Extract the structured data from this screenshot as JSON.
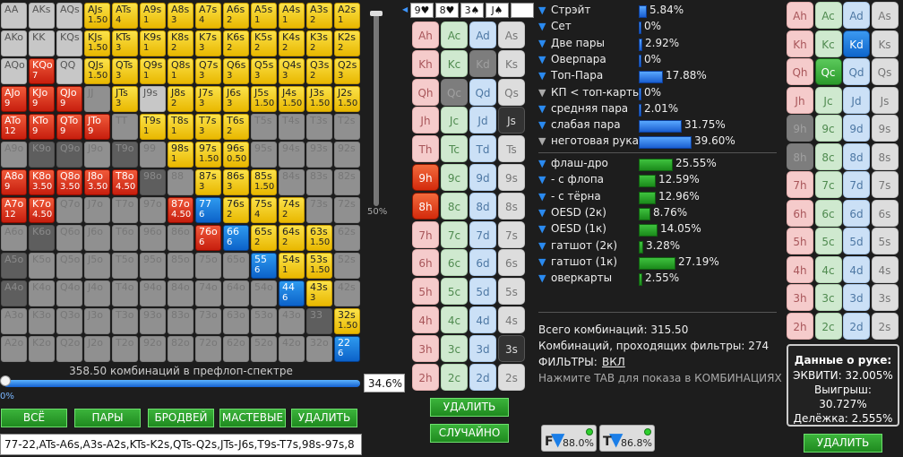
{
  "grid": [
    [
      {
        "h": "AA",
        "c": "w"
      },
      {
        "h": "AKs",
        "c": "w"
      },
      {
        "h": "AQs",
        "c": "w"
      },
      {
        "h": "AJs",
        "w": "1.50",
        "c": "y"
      },
      {
        "h": "ATs",
        "w": "4",
        "c": "y"
      },
      {
        "h": "A9s",
        "w": "1",
        "c": "y"
      },
      {
        "h": "A8s",
        "w": "3",
        "c": "y"
      },
      {
        "h": "A7s",
        "w": "4",
        "c": "y"
      },
      {
        "h": "A6s",
        "w": "2",
        "c": "y"
      },
      {
        "h": "A5s",
        "w": "1",
        "c": "y"
      },
      {
        "h": "A4s",
        "w": "1",
        "c": "y"
      },
      {
        "h": "A3s",
        "w": "2",
        "c": "y"
      },
      {
        "h": "A2s",
        "w": "1",
        "c": "y"
      }
    ],
    [
      {
        "h": "AKo",
        "c": "w"
      },
      {
        "h": "KK",
        "c": "w"
      },
      {
        "h": "KQs",
        "c": "w"
      },
      {
        "h": "KJs",
        "w": "1.50",
        "c": "y"
      },
      {
        "h": "KTs",
        "w": "3",
        "c": "y"
      },
      {
        "h": "K9s",
        "w": "1",
        "c": "y"
      },
      {
        "h": "K8s",
        "w": "2",
        "c": "y"
      },
      {
        "h": "K7s",
        "w": "3",
        "c": "y"
      },
      {
        "h": "K6s",
        "w": "2",
        "c": "y"
      },
      {
        "h": "K5s",
        "w": "2",
        "c": "y"
      },
      {
        "h": "K4s",
        "w": "2",
        "c": "y"
      },
      {
        "h": "K3s",
        "w": "2",
        "c": "y"
      },
      {
        "h": "K2s",
        "w": "2",
        "c": "y"
      }
    ],
    [
      {
        "h": "AQo",
        "c": "w"
      },
      {
        "h": "KQo",
        "w": "7",
        "c": "r"
      },
      {
        "h": "QQ",
        "c": "w"
      },
      {
        "h": "QJs",
        "w": "1.50",
        "c": "y"
      },
      {
        "h": "QTs",
        "w": "3",
        "c": "y"
      },
      {
        "h": "Q9s",
        "w": "1",
        "c": "y"
      },
      {
        "h": "Q8s",
        "w": "1",
        "c": "y"
      },
      {
        "h": "Q7s",
        "w": "3",
        "c": "y"
      },
      {
        "h": "Q6s",
        "w": "3",
        "c": "y"
      },
      {
        "h": "Q5s",
        "w": "3",
        "c": "y"
      },
      {
        "h": "Q4s",
        "w": "3",
        "c": "y"
      },
      {
        "h": "Q3s",
        "w": "2",
        "c": "y"
      },
      {
        "h": "Q2s",
        "w": "3",
        "c": "y"
      }
    ],
    [
      {
        "h": "AJo",
        "w": "9",
        "c": "r"
      },
      {
        "h": "KJo",
        "w": "9",
        "c": "r"
      },
      {
        "h": "QJo",
        "w": "9",
        "c": "r"
      },
      {
        "h": "JJ",
        "c": "g"
      },
      {
        "h": "JTs",
        "w": "3",
        "c": "y"
      },
      {
        "h": "J9s",
        "c": "w"
      },
      {
        "h": "J8s",
        "w": "2",
        "c": "y"
      },
      {
        "h": "J7s",
        "w": "3",
        "c": "y"
      },
      {
        "h": "J6s",
        "w": "3",
        "c": "y"
      },
      {
        "h": "J5s",
        "w": "1.50",
        "c": "y"
      },
      {
        "h": "J4s",
        "w": "1.50",
        "c": "y"
      },
      {
        "h": "J3s",
        "w": "1.50",
        "c": "y"
      },
      {
        "h": "J2s",
        "w": "1.50",
        "c": "y"
      }
    ],
    [
      {
        "h": "ATo",
        "w": "12",
        "c": "r"
      },
      {
        "h": "KTo",
        "w": "9",
        "c": "r"
      },
      {
        "h": "QTo",
        "w": "9",
        "c": "r"
      },
      {
        "h": "JTo",
        "w": "9",
        "c": "r"
      },
      {
        "h": "TT",
        "c": "g"
      },
      {
        "h": "T9s",
        "w": "1",
        "c": "y"
      },
      {
        "h": "T8s",
        "w": "1",
        "c": "y"
      },
      {
        "h": "T7s",
        "w": "3",
        "c": "y"
      },
      {
        "h": "T6s",
        "w": "2",
        "c": "y"
      },
      {
        "h": "T5s",
        "c": "g"
      },
      {
        "h": "T4s",
        "c": "g"
      },
      {
        "h": "T3s",
        "c": "g"
      },
      {
        "h": "T2s",
        "c": "g"
      }
    ],
    [
      {
        "h": "A9o",
        "c": "g"
      },
      {
        "h": "K9o",
        "c": "gd"
      },
      {
        "h": "Q9o",
        "c": "gd"
      },
      {
        "h": "J9o",
        "c": "g"
      },
      {
        "h": "T9o",
        "c": "gd"
      },
      {
        "h": "99",
        "c": "g"
      },
      {
        "h": "98s",
        "w": "1",
        "c": "y"
      },
      {
        "h": "97s",
        "w": "1.50",
        "c": "y"
      },
      {
        "h": "96s",
        "w": "0.50",
        "c": "y"
      },
      {
        "h": "95s",
        "c": "g"
      },
      {
        "h": "94s",
        "c": "g"
      },
      {
        "h": "93s",
        "c": "g"
      },
      {
        "h": "92s",
        "c": "g"
      }
    ],
    [
      {
        "h": "A8o",
        "w": "9",
        "c": "r"
      },
      {
        "h": "K8o",
        "w": "3.50",
        "c": "r"
      },
      {
        "h": "Q8o",
        "w": "3.50",
        "c": "r"
      },
      {
        "h": "J8o",
        "w": "3.50",
        "c": "r"
      },
      {
        "h": "T8o",
        "w": "4.50",
        "c": "r"
      },
      {
        "h": "98o",
        "c": "gd"
      },
      {
        "h": "88",
        "c": "g"
      },
      {
        "h": "87s",
        "w": "3",
        "c": "y"
      },
      {
        "h": "86s",
        "w": "3",
        "c": "y"
      },
      {
        "h": "85s",
        "w": "1.50",
        "c": "y"
      },
      {
        "h": "84s",
        "c": "g"
      },
      {
        "h": "83s",
        "c": "g"
      },
      {
        "h": "82s",
        "c": "g"
      }
    ],
    [
      {
        "h": "A7o",
        "w": "12",
        "c": "r"
      },
      {
        "h": "K7o",
        "w": "4.50",
        "c": "r"
      },
      {
        "h": "Q7o",
        "c": "g"
      },
      {
        "h": "J7o",
        "c": "g"
      },
      {
        "h": "T7o",
        "c": "g"
      },
      {
        "h": "97o",
        "c": "g"
      },
      {
        "h": "87o",
        "w": "4.50",
        "c": "r"
      },
      {
        "h": "77",
        "w": "6",
        "c": "b"
      },
      {
        "h": "76s",
        "w": "2",
        "c": "y"
      },
      {
        "h": "75s",
        "w": "4",
        "c": "y"
      },
      {
        "h": "74s",
        "w": "2",
        "c": "y"
      },
      {
        "h": "73s",
        "c": "g"
      },
      {
        "h": "72s",
        "c": "g"
      }
    ],
    [
      {
        "h": "A6o",
        "c": "g"
      },
      {
        "h": "K6o",
        "c": "gd"
      },
      {
        "h": "Q6o",
        "c": "g"
      },
      {
        "h": "J6o",
        "c": "g"
      },
      {
        "h": "T6o",
        "c": "g"
      },
      {
        "h": "96o",
        "c": "g"
      },
      {
        "h": "86o",
        "c": "g"
      },
      {
        "h": "76o",
        "w": "6",
        "c": "r"
      },
      {
        "h": "66",
        "w": "6",
        "c": "b"
      },
      {
        "h": "65s",
        "w": "2",
        "c": "y"
      },
      {
        "h": "64s",
        "w": "2",
        "c": "y"
      },
      {
        "h": "63s",
        "w": "1.50",
        "c": "y"
      },
      {
        "h": "62s",
        "c": "g"
      }
    ],
    [
      {
        "h": "A5o",
        "c": "gd"
      },
      {
        "h": "K5o",
        "c": "g"
      },
      {
        "h": "Q5o",
        "c": "g"
      },
      {
        "h": "J5o",
        "c": "g"
      },
      {
        "h": "T5o",
        "c": "g"
      },
      {
        "h": "95o",
        "c": "g"
      },
      {
        "h": "85o",
        "c": "g"
      },
      {
        "h": "75o",
        "c": "g"
      },
      {
        "h": "65o",
        "c": "g"
      },
      {
        "h": "55",
        "w": "6",
        "c": "b"
      },
      {
        "h": "54s",
        "w": "1",
        "c": "y"
      },
      {
        "h": "53s",
        "w": "1.50",
        "c": "y"
      },
      {
        "h": "52s",
        "c": "g"
      }
    ],
    [
      {
        "h": "A4o",
        "c": "gd"
      },
      {
        "h": "K4o",
        "c": "g"
      },
      {
        "h": "Q4o",
        "c": "g"
      },
      {
        "h": "J4o",
        "c": "g"
      },
      {
        "h": "T4o",
        "c": "g"
      },
      {
        "h": "94o",
        "c": "g"
      },
      {
        "h": "84o",
        "c": "g"
      },
      {
        "h": "74o",
        "c": "g"
      },
      {
        "h": "64o",
        "c": "g"
      },
      {
        "h": "54o",
        "c": "g"
      },
      {
        "h": "44",
        "w": "6",
        "c": "b"
      },
      {
        "h": "43s",
        "w": "3",
        "c": "y"
      },
      {
        "h": "42s",
        "c": "g"
      }
    ],
    [
      {
        "h": "A3o",
        "c": "g"
      },
      {
        "h": "K3o",
        "c": "g"
      },
      {
        "h": "Q3o",
        "c": "g"
      },
      {
        "h": "J3o",
        "c": "g"
      },
      {
        "h": "T3o",
        "c": "g"
      },
      {
        "h": "93o",
        "c": "g"
      },
      {
        "h": "83o",
        "c": "g"
      },
      {
        "h": "73o",
        "c": "g"
      },
      {
        "h": "63o",
        "c": "g"
      },
      {
        "h": "53o",
        "c": "g"
      },
      {
        "h": "43o",
        "c": "g"
      },
      {
        "h": "33",
        "c": "gd"
      },
      {
        "h": "32s",
        "w": "1.50",
        "c": "y"
      }
    ],
    [
      {
        "h": "A2o",
        "c": "g"
      },
      {
        "h": "K2o",
        "c": "g"
      },
      {
        "h": "Q2o",
        "c": "g"
      },
      {
        "h": "J2o",
        "c": "g"
      },
      {
        "h": "T2o",
        "c": "g"
      },
      {
        "h": "92o",
        "c": "g"
      },
      {
        "h": "82o",
        "c": "g"
      },
      {
        "h": "72o",
        "c": "g"
      },
      {
        "h": "62o",
        "c": "g"
      },
      {
        "h": "52o",
        "c": "g"
      },
      {
        "h": "42o",
        "c": "g"
      },
      {
        "h": "32o",
        "c": "g"
      },
      {
        "h": "22",
        "w": "6",
        "c": "b"
      }
    ]
  ],
  "vslider_pct": "50%",
  "preflop_label": "358.50 комбинаций в префлоп-спектре",
  "hslider_left": "0%",
  "pct_box": "34.6%",
  "buttons": {
    "all": "ВСЁ",
    "pairs": "ПАРЫ",
    "broadway": "БРОДВЕЙ",
    "suited": "МАСТЕВЫЕ",
    "delete": "УДАЛИТЬ"
  },
  "range_string": "77-22,ATs-A6s,A3s-A2s,KTs-K2s,QTs-Q2s,JTs-J6s,T9s-T7s,98s-97s,8",
  "board": [
    "9♥",
    "8♥",
    "3♠",
    "J♠",
    ""
  ],
  "matrix": [
    [
      {
        "t": "Ah",
        "s": "hp"
      },
      {
        "t": "Ac",
        "s": "cp"
      },
      {
        "t": "Ad",
        "s": "dp"
      },
      {
        "t": "As",
        "s": "sp"
      }
    ],
    [
      {
        "t": "Kh",
        "s": "hp"
      },
      {
        "t": "Kc",
        "s": "cp"
      },
      {
        "t": "Kd",
        "s": "hd"
      },
      {
        "t": "Ks",
        "s": "sp"
      }
    ],
    [
      {
        "t": "Qh",
        "s": "hp"
      },
      {
        "t": "Qc",
        "s": "hd"
      },
      {
        "t": "Qd",
        "s": "dp"
      },
      {
        "t": "Qs",
        "s": "sp"
      }
    ],
    [
      {
        "t": "Jh",
        "s": "hp"
      },
      {
        "t": "Jc",
        "s": "cp"
      },
      {
        "t": "Jd",
        "s": "dp"
      },
      {
        "t": "Js",
        "s": "sk",
        "b": "T"
      }
    ],
    [
      {
        "t": "Th",
        "s": "hp"
      },
      {
        "t": "Tc",
        "s": "cp"
      },
      {
        "t": "Td",
        "s": "dp"
      },
      {
        "t": "Ts",
        "s": "sp"
      }
    ],
    [
      {
        "t": "9h",
        "s": "hr"
      },
      {
        "t": "9c",
        "s": "cp"
      },
      {
        "t": "9d",
        "s": "dp"
      },
      {
        "t": "9s",
        "s": "sp"
      }
    ],
    [
      {
        "t": "8h",
        "s": "hr"
      },
      {
        "t": "8c",
        "s": "cp"
      },
      {
        "t": "8d",
        "s": "dp"
      },
      {
        "t": "8s",
        "s": "sp"
      }
    ],
    [
      {
        "t": "7h",
        "s": "hp"
      },
      {
        "t": "7c",
        "s": "cp"
      },
      {
        "t": "7d",
        "s": "dp"
      },
      {
        "t": "7s",
        "s": "sp"
      }
    ],
    [
      {
        "t": "6h",
        "s": "hp"
      },
      {
        "t": "6c",
        "s": "cp"
      },
      {
        "t": "6d",
        "s": "dp"
      },
      {
        "t": "6s",
        "s": "sp"
      }
    ],
    [
      {
        "t": "5h",
        "s": "hp"
      },
      {
        "t": "5c",
        "s": "cp"
      },
      {
        "t": "5d",
        "s": "dp"
      },
      {
        "t": "5s",
        "s": "sp"
      }
    ],
    [
      {
        "t": "4h",
        "s": "hp"
      },
      {
        "t": "4c",
        "s": "cp"
      },
      {
        "t": "4d",
        "s": "dp"
      },
      {
        "t": "4s",
        "s": "sp"
      }
    ],
    [
      {
        "t": "3h",
        "s": "hp"
      },
      {
        "t": "3c",
        "s": "cp"
      },
      {
        "t": "3d",
        "s": "dp"
      },
      {
        "t": "3s",
        "s": "sk"
      }
    ],
    [
      {
        "t": "2h",
        "s": "hp"
      },
      {
        "t": "2c",
        "s": "cp"
      },
      {
        "t": "2d",
        "s": "dp"
      },
      {
        "t": "2s",
        "s": "sp"
      }
    ]
  ],
  "matrix_buttons": {
    "delete": "УДАЛИТЬ",
    "random": "СЛУЧАЙНО"
  },
  "stats": [
    {
      "name": "Стрэйт",
      "pct": "5.84%",
      "v": 5.84,
      "bar": "b",
      "icon": "blue"
    },
    {
      "name": "Сет",
      "pct": "0%",
      "v": 0,
      "bar": "b",
      "icon": "blue"
    },
    {
      "name": "Две пары",
      "pct": "2.92%",
      "v": 2.92,
      "bar": "b",
      "icon": "blue"
    },
    {
      "name": "Оверпара",
      "pct": "0%",
      "v": 0,
      "bar": "b",
      "icon": "blue"
    },
    {
      "name": "Топ-Пара",
      "pct": "17.88%",
      "v": 17.88,
      "bar": "b",
      "icon": "blue"
    },
    {
      "name": "КП < топ-карты",
      "pct": "0%",
      "v": 0,
      "bar": "b",
      "icon": "grey"
    },
    {
      "name": "средняя пара",
      "pct": "2.01%",
      "v": 2.01,
      "bar": "b",
      "icon": "blue"
    },
    {
      "name": "слабая пара",
      "pct": "31.75%",
      "v": 31.75,
      "bar": "b",
      "icon": "blue"
    },
    {
      "name": "неготовая рука",
      "pct": "39.60%",
      "v": 39.6,
      "bar": "b",
      "icon": "grey"
    }
  ],
  "draws": [
    {
      "name": "флаш-дро",
      "pct": "25.55%",
      "v": 25.55
    },
    {
      "name": "- с флопа",
      "pct": "12.59%",
      "v": 12.59
    },
    {
      "name": "- с тёрна",
      "pct": "12.96%",
      "v": 12.96
    },
    {
      "name": "OESD (2к)",
      "pct": "8.76%",
      "v": 8.76
    },
    {
      "name": "OESD (1к)",
      "pct": "14.05%",
      "v": 14.05
    },
    {
      "name": "гатшот (2к)",
      "pct": "3.28%",
      "v": 3.28
    },
    {
      "name": "гатшот (1к)",
      "pct": "27.19%",
      "v": 27.19
    },
    {
      "name": "оверкарты",
      "pct": "2.55%",
      "v": 2.55
    }
  ],
  "summary": {
    "total": "Всего комбинаций: 315.50",
    "filtered": "Комбинаций, проходящих фильтры: 274",
    "filters_label": "ФИЛЬТРЫ:",
    "filters_value": "ВКЛ",
    "hint": "Нажмите TAB для показа в КОМБИНАЦИЯХ"
  },
  "ft": {
    "f_letter": "F",
    "f_pct": "88.0%",
    "t_letter": "T",
    "t_pct": "86.8%"
  },
  "right_matrix": [
    [
      {
        "t": "Ah",
        "s": "hp"
      },
      {
        "t": "Ac",
        "s": "cp"
      },
      {
        "t": "Ad",
        "s": "dp"
      },
      {
        "t": "As",
        "s": "sp"
      }
    ],
    [
      {
        "t": "Kh",
        "s": "hp"
      },
      {
        "t": "Kc",
        "s": "cp"
      },
      {
        "t": "Kd",
        "s": "db"
      },
      {
        "t": "Ks",
        "s": "sp"
      }
    ],
    [
      {
        "t": "Qh",
        "s": "hp"
      },
      {
        "t": "Qc",
        "s": "cg"
      },
      {
        "t": "Qd",
        "s": "dp"
      },
      {
        "t": "Qs",
        "s": "sp"
      }
    ],
    [
      {
        "t": "Jh",
        "s": "hp"
      },
      {
        "t": "Jc",
        "s": "cp"
      },
      {
        "t": "Jd",
        "s": "dp"
      },
      {
        "t": "Js",
        "s": "sp"
      }
    ],
    [
      {
        "t": "9h",
        "s": "hd"
      },
      {
        "t": "9c",
        "s": "cp"
      },
      {
        "t": "9d",
        "s": "dp"
      },
      {
        "t": "9s",
        "s": "sp"
      }
    ],
    [
      {
        "t": "8h",
        "s": "hd"
      },
      {
        "t": "8c",
        "s": "cp"
      },
      {
        "t": "8d",
        "s": "dp"
      },
      {
        "t": "8s",
        "s": "sp"
      }
    ],
    [
      {
        "t": "7h",
        "s": "hp"
      },
      {
        "t": "7c",
        "s": "cp"
      },
      {
        "t": "7d",
        "s": "dp"
      },
      {
        "t": "7s",
        "s": "sp"
      }
    ],
    [
      {
        "t": "6h",
        "s": "hp"
      },
      {
        "t": "6c",
        "s": "cp"
      },
      {
        "t": "6d",
        "s": "dp"
      },
      {
        "t": "6s",
        "s": "sp"
      }
    ],
    [
      {
        "t": "5h",
        "s": "hp"
      },
      {
        "t": "5c",
        "s": "cp"
      },
      {
        "t": "5d",
        "s": "dp"
      },
      {
        "t": "5s",
        "s": "sp"
      }
    ],
    [
      {
        "t": "4h",
        "s": "hp"
      },
      {
        "t": "4c",
        "s": "cp"
      },
      {
        "t": "4d",
        "s": "dp"
      },
      {
        "t": "4s",
        "s": "sp"
      }
    ],
    [
      {
        "t": "3h",
        "s": "hp"
      },
      {
        "t": "3c",
        "s": "cp"
      },
      {
        "t": "3d",
        "s": "dp"
      },
      {
        "t": "3s",
        "s": "sp"
      }
    ],
    [
      {
        "t": "2h",
        "s": "hp"
      },
      {
        "t": "2c",
        "s": "cp"
      },
      {
        "t": "2d",
        "s": "dp"
      },
      {
        "t": "2s",
        "s": "sp"
      }
    ]
  ],
  "hand_data": {
    "title": "Данные о руке:",
    "equity": "ЭКВИТИ: 32.005%",
    "win": "Выигрыш: 30.727%",
    "tie": "Делёжка: 2.555%",
    "delete": "УДАЛИТЬ"
  }
}
